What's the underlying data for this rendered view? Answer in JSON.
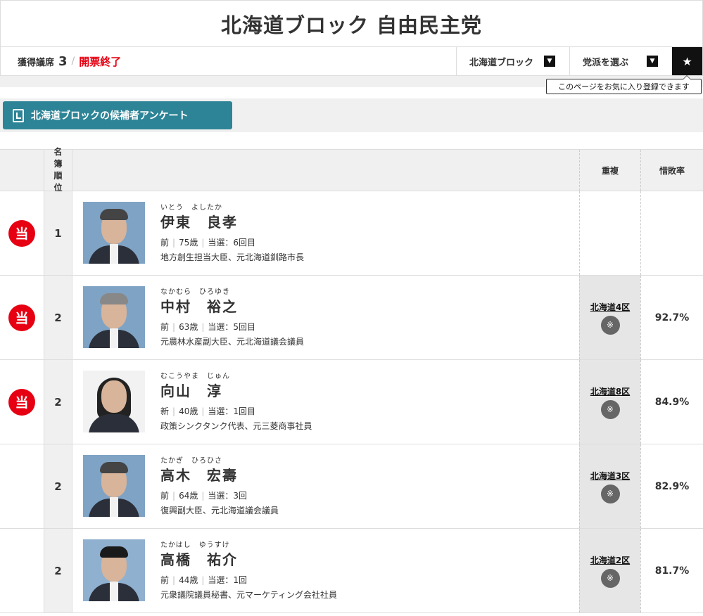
{
  "header": {
    "title": "北海道ブロック 自由民主党"
  },
  "info": {
    "seat_label": "獲得議席",
    "seat_count": "3",
    "slash": "/",
    "status": "開票終了",
    "block_select": "北海道ブロック",
    "party_select": "党派を選ぶ",
    "fav_icon": "★",
    "fav_tooltip": "このページをお気に入り登録できます"
  },
  "survey": {
    "label": "北海道ブロックの候補者アンケート"
  },
  "table": {
    "headers": {
      "rank": "名簿順位",
      "dup": "重複",
      "rate": "惜敗率"
    },
    "win_label": "当",
    "rows": [
      {
        "won": true,
        "rank": "1",
        "kana": "いとう　よしたか",
        "name": "伊東　良孝",
        "status": "前",
        "age": "75歳",
        "times": "当選：6回目",
        "career": "地方創生担当大臣、元北海道釧路市長",
        "district": "",
        "note": "",
        "rate": ""
      },
      {
        "won": true,
        "rank": "2",
        "kana": "なかむら　ひろゆき",
        "name": "中村　裕之",
        "status": "前",
        "age": "63歳",
        "times": "当選：5回目",
        "career": "元農林水産副大臣、元北海道議会議員",
        "district": "北海道4区",
        "note": "※",
        "rate": "92.7%"
      },
      {
        "won": true,
        "rank": "2",
        "kana": "むこうやま　じゅん",
        "name": "向山　淳",
        "status": "新",
        "age": "40歳",
        "times": "当選：1回目",
        "career": "政策シンクタンク代表、元三菱商事社員",
        "district": "北海道8区",
        "note": "※",
        "rate": "84.9%"
      },
      {
        "won": false,
        "rank": "2",
        "kana": "たかぎ　ひろひさ",
        "name": "高木　宏壽",
        "status": "前",
        "age": "64歳",
        "times": "当選：3回",
        "career": "復興副大臣、元北海道議会議員",
        "district": "北海道3区",
        "note": "※",
        "rate": "82.9%"
      },
      {
        "won": false,
        "rank": "2",
        "kana": "たかはし　ゆうすけ",
        "name": "高橋　祐介",
        "status": "前",
        "age": "44歳",
        "times": "当選：1回",
        "career": "元衆議院議員秘書、元マーケティング会社社員",
        "district": "北海道2区",
        "note": "※",
        "rate": "81.7%"
      }
    ]
  }
}
